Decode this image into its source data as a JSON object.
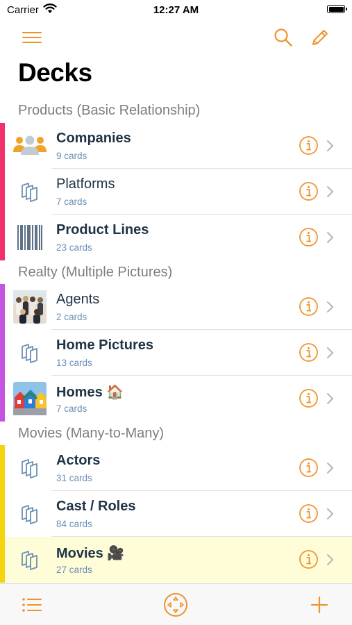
{
  "status_bar": {
    "carrier": "Carrier",
    "time": "12:27 AM"
  },
  "nav": {
    "menu_icon": "hamburger-menu-icon",
    "search_icon": "search-icon",
    "edit_icon": "pencil-icon",
    "accent_color": "#f0922b"
  },
  "page": {
    "title": "Decks"
  },
  "sections": [
    {
      "header": "Products (Basic Relationship)",
      "color": "#f0316a",
      "rows": [
        {
          "title": "Companies",
          "subtitle": "9 cards",
          "icon": "people-icon",
          "bold": true
        },
        {
          "title": "Platforms",
          "subtitle": "7 cards",
          "icon": "cards-stack-icon",
          "bold": false
        },
        {
          "title": "Product Lines",
          "subtitle": "23 cards",
          "icon": "barcode-icon",
          "bold": true
        }
      ]
    },
    {
      "header": "Realty (Multiple Pictures)",
      "color": "#c453e0",
      "rows": [
        {
          "title": "Agents",
          "subtitle": "2 cards",
          "icon": "agents-photo",
          "bold": false
        },
        {
          "title": "Home Pictures",
          "subtitle": "13 cards",
          "icon": "cards-stack-icon",
          "bold": true
        },
        {
          "title": "Homes 🏠",
          "subtitle": "7 cards",
          "icon": "homes-photo",
          "bold": true
        }
      ]
    },
    {
      "header": "Movies (Many-to-Many)",
      "color": "#f5d30f",
      "rows": [
        {
          "title": "Actors",
          "subtitle": "31 cards",
          "icon": "cards-stack-icon",
          "bold": true
        },
        {
          "title": "Cast / Roles",
          "subtitle": "84 cards",
          "icon": "cards-stack-icon",
          "bold": true
        },
        {
          "title": "Movies 🎥",
          "subtitle": "27 cards",
          "icon": "cards-stack-icon",
          "bold": true,
          "selected": true
        }
      ]
    }
  ],
  "tab_bar": {
    "list_icon": "list-icon",
    "center_icon": "focus-target-icon",
    "add_icon": "plus-icon"
  }
}
